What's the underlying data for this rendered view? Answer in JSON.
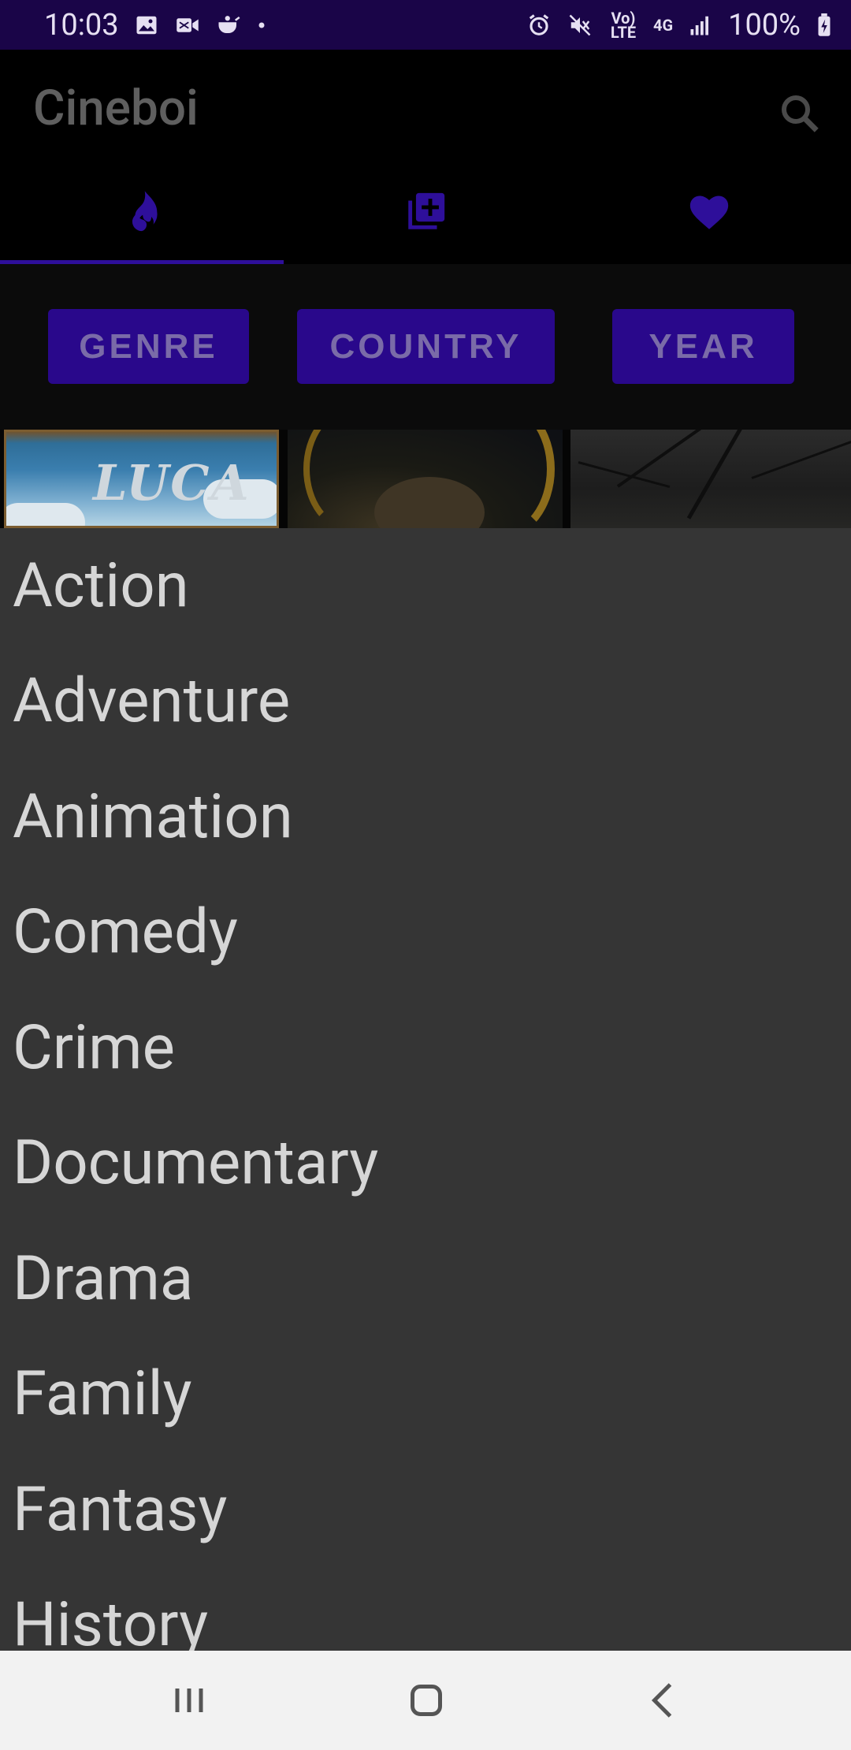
{
  "status_bar": {
    "time": "10:03",
    "left_icons": [
      "image-icon",
      "video-call-icon",
      "tea-cup-icon",
      "dot-icon"
    ],
    "volte_label": "Vo) LTE",
    "network_label": "4G",
    "battery_percent": "100%"
  },
  "app_bar": {
    "title": "Cineboi",
    "search_icon": "search-icon"
  },
  "tabs": [
    {
      "icon": "fire-icon",
      "selected": true
    },
    {
      "icon": "library-add-icon",
      "selected": false
    },
    {
      "icon": "heart-icon",
      "selected": false
    }
  ],
  "filters": {
    "genre_label": "GENRE",
    "country_label": "COUNTRY",
    "year_label": "YEAR"
  },
  "posters": {
    "poster_1_title": "LUCA"
  },
  "genre_menu": {
    "items": [
      "Action",
      "Adventure",
      "Animation",
      "Comedy",
      "Crime",
      "Documentary",
      "Drama",
      "Family",
      "Fantasy",
      "History"
    ]
  },
  "nav_bar": {
    "icons": [
      "recents-icon",
      "home-icon",
      "back-icon"
    ]
  },
  "colors": {
    "status_bar_bg": "#1a0548",
    "accent": "#29088b",
    "tab_icon": "#2e0f9a",
    "menu_bg": "#353535",
    "menu_text": "#d6d6d6",
    "nav_bg": "#f2f2f2"
  }
}
